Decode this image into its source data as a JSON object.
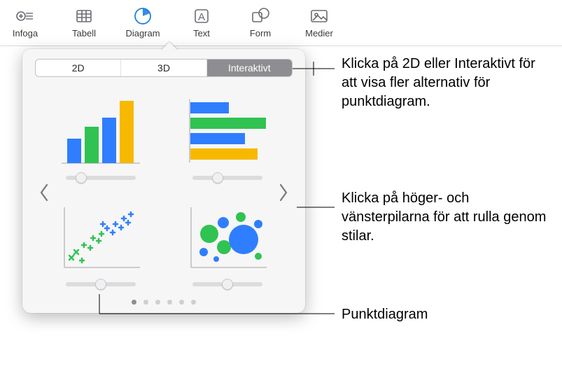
{
  "toolbar": {
    "items": [
      {
        "label": "Infoga"
      },
      {
        "label": "Tabell"
      },
      {
        "label": "Diagram"
      },
      {
        "label": "Text"
      },
      {
        "label": "Form"
      },
      {
        "label": "Medier"
      }
    ]
  },
  "popover": {
    "tabs": {
      "tab_2d": "2D",
      "tab_3d": "3D",
      "tab_interactive": "Interaktivt",
      "active": "Interaktivt"
    }
  },
  "callouts": {
    "tabs_note": "Klicka på 2D eller Interaktivt för att visa fler alternativ för punktdiagram.",
    "arrows_note": "Klicka på höger- och vänsterpilarna för att rulla genom stilar.",
    "scatter_label": "Punktdiagram"
  },
  "palette": {
    "blue": "#2f7eff",
    "green": "#30c352",
    "yellow": "#f6b900"
  }
}
